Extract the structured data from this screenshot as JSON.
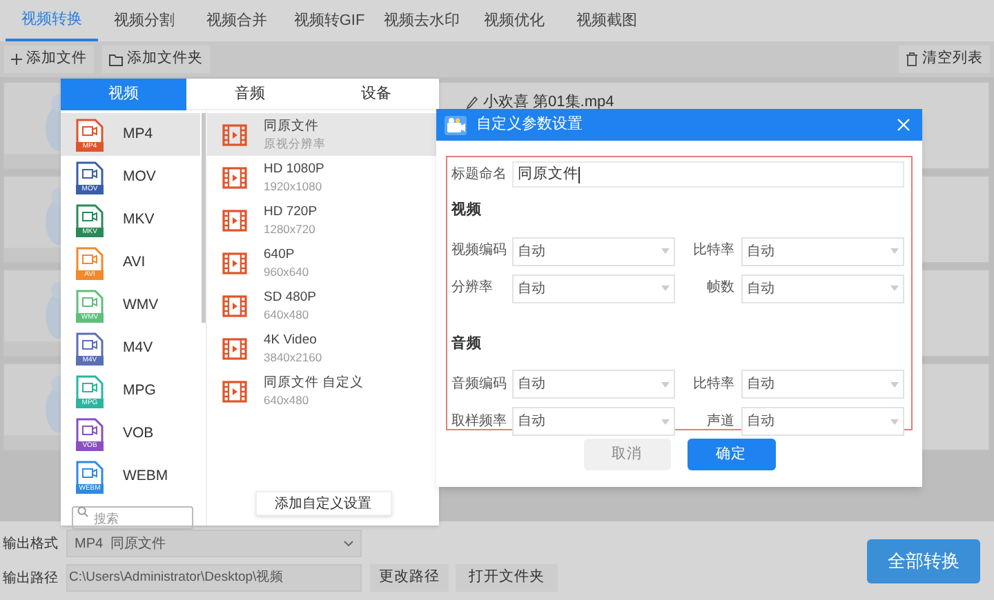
{
  "tabs": [
    {
      "label": "视频转换",
      "selected": true
    },
    {
      "label": "视频分割",
      "selected": false
    },
    {
      "label": "视频合并",
      "selected": false
    },
    {
      "label": "视频转GIF",
      "selected": false
    },
    {
      "label": "视频去水印",
      "selected": false
    },
    {
      "label": "视频优化",
      "selected": false
    },
    {
      "label": "视频截图",
      "selected": false
    }
  ],
  "toolbar": {
    "add_file": "添加文件",
    "add_folder": "添加文件夹",
    "clear_list": "清空列表"
  },
  "file_list": {
    "file_name": "小欢喜 第01集.mp4"
  },
  "format_popup": {
    "tabs": [
      {
        "label": "视频",
        "selected": true
      },
      {
        "label": "音频",
        "selected": false
      },
      {
        "label": "设备",
        "selected": false
      }
    ],
    "formats": [
      {
        "label": "MP4",
        "badge": "MP4",
        "color": "#e0542a",
        "selected": true
      },
      {
        "label": "MOV",
        "badge": "MOV",
        "color": "#3b5ea8",
        "selected": false
      },
      {
        "label": "MKV",
        "badge": "MKV",
        "color": "#2a8a57",
        "selected": false
      },
      {
        "label": "AVI",
        "badge": "AVI",
        "color": "#f08a2c",
        "selected": false
      },
      {
        "label": "WMV",
        "badge": "WMV",
        "color": "#5fbf7a",
        "selected": false
      },
      {
        "label": "M4V",
        "badge": "M4V",
        "color": "#5a6fb5",
        "selected": false
      },
      {
        "label": "MPG",
        "badge": "MPG",
        "color": "#2bb5a0",
        "selected": false
      },
      {
        "label": "VOB",
        "badge": "VOB",
        "color": "#8a4fc2",
        "selected": false
      },
      {
        "label": "WEBM",
        "badge": "WEBM",
        "color": "#2f8ae0",
        "selected": false
      }
    ],
    "presets": [
      {
        "title": "同原文件",
        "subtitle": "原视分辨率",
        "selected": true
      },
      {
        "title": "HD 1080P",
        "subtitle": "1920x1080",
        "selected": false
      },
      {
        "title": "HD 720P",
        "subtitle": "1280x720",
        "selected": false
      },
      {
        "title": "640P",
        "subtitle": "960x640",
        "selected": false
      },
      {
        "title": "SD 480P",
        "subtitle": "640x480",
        "selected": false
      },
      {
        "title": "4K Video",
        "subtitle": "3840x2160",
        "selected": false
      },
      {
        "title": "同原文件 自定义",
        "subtitle": "640x480",
        "selected": false
      }
    ],
    "search": {
      "placeholder": "搜索"
    },
    "add_custom": "添加自定义设置"
  },
  "dialog": {
    "title": "自定义参数设置",
    "name_label": "标题命名",
    "name_value": "同原文件",
    "video_heading": "视频",
    "video_fields": [
      {
        "label": "视频编码",
        "value": "自动"
      },
      {
        "label": "比特率",
        "value": "自动"
      },
      {
        "label": "分辨率",
        "value": "自动"
      },
      {
        "label": "帧数",
        "value": "自动"
      }
    ],
    "audio_heading": "音频",
    "audio_fields": [
      {
        "label": "音频编码",
        "value": "自动"
      },
      {
        "label": "比特率",
        "value": "自动"
      },
      {
        "label": "取样频率",
        "value": "自动"
      },
      {
        "label": "声道",
        "value": "自动"
      }
    ],
    "cancel": "取消",
    "ok": "确定"
  },
  "bottom": {
    "format_label": "输出格式",
    "format_value": "MP4  同原文件",
    "path_label": "输出路径",
    "path_value": "C:\\Users\\Administrator\\Desktop\\视频",
    "change_path": "更改路径",
    "open_folder": "打开文件夹",
    "convert_all": "全部转换"
  }
}
